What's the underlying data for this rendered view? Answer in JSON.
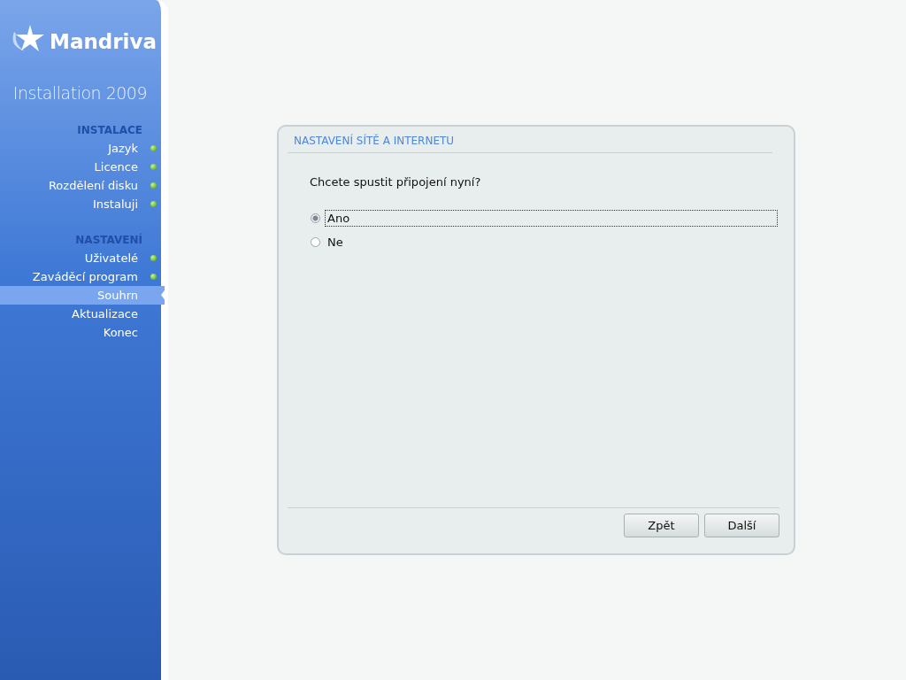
{
  "logo": {
    "brand": "Mandriva",
    "subtitle": "Installation 2009"
  },
  "sidebar": {
    "sections": [
      {
        "title": "INSTALACE",
        "items": [
          {
            "label": "Jazyk",
            "done": true,
            "selected": false
          },
          {
            "label": "Licence",
            "done": true,
            "selected": false
          },
          {
            "label": "Rozdělení disku",
            "done": true,
            "selected": false
          },
          {
            "label": "Instaluji",
            "done": true,
            "selected": false
          }
        ]
      },
      {
        "title": "NASTAVENÍ",
        "items": [
          {
            "label": "Uživatelé",
            "done": true,
            "selected": false
          },
          {
            "label": "Zaváděcí program",
            "done": true,
            "selected": false
          },
          {
            "label": "Souhrn",
            "done": false,
            "selected": true
          },
          {
            "label": "Aktualizace",
            "done": false,
            "selected": false
          },
          {
            "label": "Konec",
            "done": false,
            "selected": false
          }
        ]
      }
    ]
  },
  "dialog": {
    "title": "NASTAVENÍ SÍTĚ A INTERNETU",
    "question": "Chcete spustit připojení nyní?",
    "options": [
      {
        "label": "Ano",
        "selected": true,
        "focused": true
      },
      {
        "label": "Ne",
        "selected": false,
        "focused": false
      }
    ],
    "buttons": [
      "Zpět",
      "Další"
    ]
  }
}
